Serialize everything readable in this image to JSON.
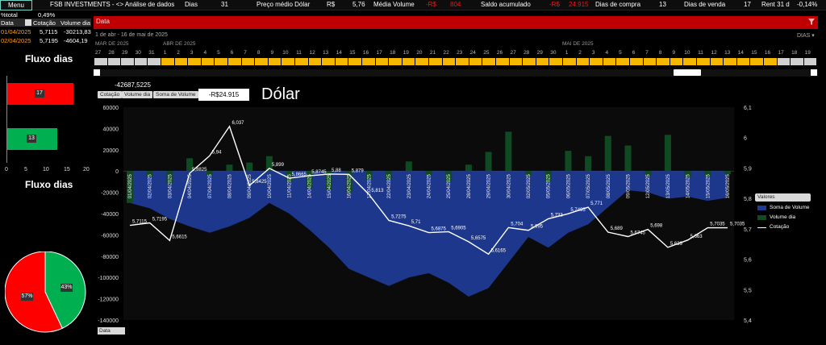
{
  "topbar": {
    "menu_label": "Menu",
    "brand": "FSB INVESTMENTS - <> Análise de dados",
    "dias_label": "Dias",
    "dias_value": "31",
    "preco_medio_label": "Preço médio Dólar",
    "preco_medio_currency": "R$",
    "preco_medio_value": "5,76",
    "media_volume_label": "Média Volume",
    "media_volume_currency": "-R$",
    "media_volume_value": "804",
    "saldo_label": "Saldo acumulado",
    "saldo_currency": "-R$",
    "saldo_value": "24.915",
    "dias_compra_label": "Dias de compra",
    "dias_compra_value": "13",
    "dias_venda_label": "Dias de venda",
    "dias_venda_value": "17",
    "rent_label": "Rent 31 d",
    "rent_value": "-0,14%"
  },
  "left_table": {
    "pct_label": "%total",
    "pct_value": "0,49%",
    "headers": [
      "Data",
      "Cotação",
      "Volume dia"
    ],
    "rows": [
      {
        "data": "01/04/2025",
        "cotacao": "5,7115",
        "volume": "-30213,83"
      },
      {
        "data": "02/04/2025",
        "cotacao": "5,7195",
        "volume": "-4604,19"
      }
    ]
  },
  "slicer": {
    "title": "Data",
    "range": "1 de abr - 16 de mai de 2025",
    "dropdown": "DIAS ▾",
    "months": [
      "MAR DE 2025",
      "ABR DE 2025",
      "MAI DE 2025"
    ],
    "days": [
      "27",
      "28",
      "29",
      "30",
      "31",
      "1",
      "2",
      "3",
      "4",
      "5",
      "6",
      "7",
      "8",
      "9",
      "10",
      "11",
      "12",
      "13",
      "14",
      "15",
      "16",
      "17",
      "18",
      "19",
      "20",
      "21",
      "22",
      "23",
      "24",
      "25",
      "26",
      "27",
      "28",
      "29",
      "30",
      "1",
      "2",
      "3",
      "4",
      "5",
      "6",
      "7",
      "8",
      "9",
      "10",
      "11",
      "12",
      "13",
      "14",
      "15",
      "16",
      "17",
      "18",
      "19"
    ]
  },
  "fluxo1": {
    "title": "Fluxo dias",
    "bars": [
      {
        "name": "venda",
        "value": 17,
        "label": "17",
        "color": "#ff0000"
      },
      {
        "name": "compra",
        "value": 13,
        "label": "13",
        "color": "#00b050"
      }
    ],
    "ticks": [
      "0",
      "5",
      "10",
      "15",
      "20"
    ]
  },
  "fluxo2": {
    "title": "Fluxo dias",
    "slices": [
      {
        "label": "57%",
        "value": 57,
        "color": "#ff0000"
      },
      {
        "label": "43%",
        "value": 43,
        "color": "#00b050"
      }
    ]
  },
  "main": {
    "buttons": [
      "Cotação",
      "Volume dia",
      "Soma de Volume"
    ],
    "value_box": "-R$24.915",
    "title": "Dólar",
    "ymax_label": "-42687,5225",
    "legend_title": "Valores",
    "legend": [
      "Soma de Volume",
      "Volume dia",
      "Cotação"
    ],
    "data_button": "Data"
  },
  "chart_data": {
    "type": "line",
    "categories": [
      "01/04/2025",
      "02/04/2025",
      "03/04/2025",
      "04/04/2025",
      "07/04/2025",
      "08/04/2025",
      "09/04/2025",
      "10/04/2025",
      "11/04/2025",
      "14/04/2025",
      "15/04/2025",
      "16/04/2025",
      "17/04/2025",
      "22/04/2025",
      "23/04/2025",
      "24/04/2025",
      "25/04/2025",
      "28/04/2025",
      "29/04/2025",
      "30/04/2025",
      "02/05/2025",
      "05/05/2025",
      "06/05/2025",
      "07/05/2025",
      "08/05/2025",
      "09/05/2025",
      "12/05/2025",
      "13/05/2025",
      "14/05/2025",
      "15/05/2025",
      "16/05/2025"
    ],
    "y_left_ticks": [
      "60000",
      "40000",
      "20000",
      "0",
      "-20000",
      "-40000",
      "-60000",
      "-80000",
      "-100000",
      "-120000",
      "-140000"
    ],
    "y_left_range": [
      -140000,
      60000
    ],
    "y_right_ticks": [
      "6,1",
      "6",
      "5,9",
      "5,8",
      "5,7",
      "5,6",
      "5,5",
      "5,4"
    ],
    "y_right_range": [
      5.4,
      6.1
    ],
    "series": [
      {
        "name": "Soma de Volume",
        "type": "area",
        "color": "#1f3a93",
        "values": [
          -30000,
          -35000,
          -45000,
          -52000,
          -58000,
          -52000,
          -44000,
          -30000,
          -40000,
          -55000,
          -72000,
          -92000,
          -100000,
          -108000,
          -100000,
          -96000,
          -105000,
          -118000,
          -110000,
          -86000,
          -62000,
          -72000,
          -58000,
          -50000,
          -34000,
          -18000,
          -20000,
          -26000,
          -24000,
          -28000,
          -24915
        ]
      },
      {
        "name": "Volume dia",
        "type": "bar",
        "color": "#0f4a22",
        "values": [
          -30000,
          -5000,
          -12000,
          12000,
          -4000,
          6000,
          8000,
          14000,
          -10000,
          -16000,
          -18000,
          -20000,
          -8000,
          -8000,
          9000,
          -4000,
          -10000,
          6000,
          18000,
          37000,
          -4000,
          -10000,
          19000,
          14000,
          33000,
          24000,
          -4000,
          34000,
          -6000,
          -5000,
          -3000
        ]
      },
      {
        "name": "Cotação",
        "type": "line",
        "color": "#ffffff",
        "values": [
          5.7115,
          5.7195,
          5.6615,
          5.8825,
          5.94,
          6.037,
          5.8425,
          5.899,
          5.8665,
          5.8745,
          5.88,
          5.879,
          5.813,
          5.7275,
          5.71,
          5.6875,
          5.6905,
          5.6575,
          5.6165,
          5.704,
          5.695,
          5.733,
          5.7495,
          5.771,
          5.689,
          5.6745,
          5.698,
          5.639,
          5.663,
          5.7035,
          5.7035
        ],
        "labels": [
          "5,7115",
          "5,7195",
          "5,6615",
          "5,8825",
          "5,94",
          "6,037",
          "5,8425",
          "5,899",
          "5,8665",
          "5,8745",
          "5,88",
          "5,879",
          "5,813",
          "5,7275",
          "5,71",
          "5,6875",
          "5,6905",
          "5,6575",
          "5,6165",
          "5,704",
          "5,695",
          "5,733",
          "5,7495",
          "5,771",
          "5,689",
          "5,6745",
          "5,698",
          "5,639",
          "5,663",
          "5,7035",
          "5,7035"
        ]
      }
    ]
  },
  "colors": {
    "accent_red": "#c00000",
    "slicer_orange": "#f5b700",
    "slicer_grey": "#d0d0d0",
    "area_blue": "#1f3a93",
    "bar_green": "#0f4a22",
    "plot_bg": "#0b0b0b"
  }
}
